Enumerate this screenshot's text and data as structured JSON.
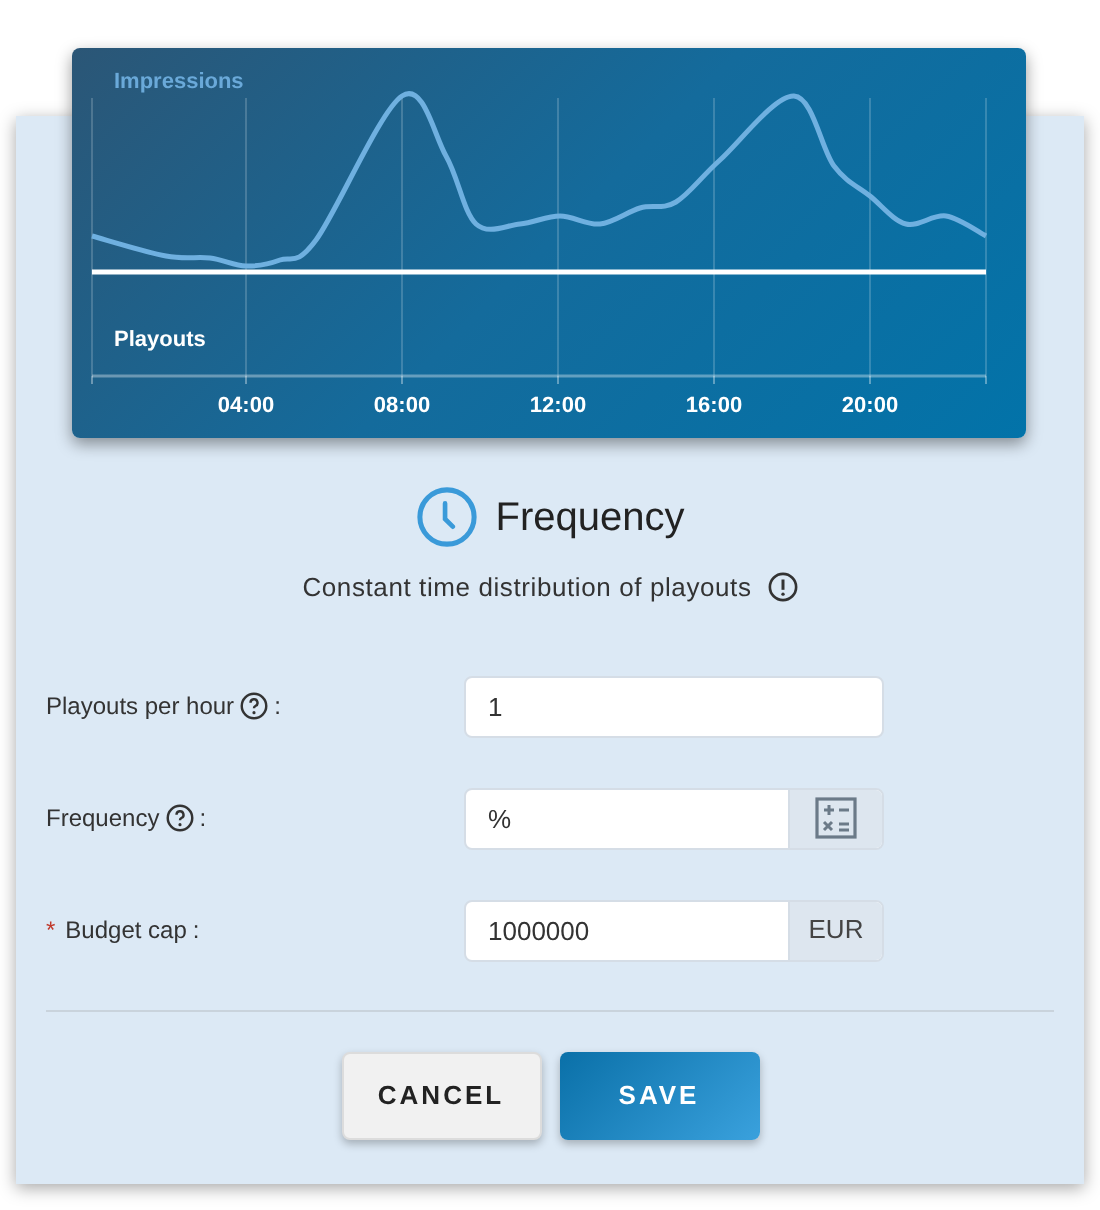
{
  "chart": {
    "impressions_label": "Impressions",
    "playouts_label": "Playouts",
    "x_ticks": [
      "04:00",
      "08:00",
      "12:00",
      "16:00",
      "20:00"
    ]
  },
  "header": {
    "title": "Frequency",
    "subtitle": "Constant time distribution of playouts"
  },
  "fields": [
    {
      "kind": "plain",
      "label": "Playouts per hour",
      "help": true,
      "required": false,
      "value": "1"
    },
    {
      "kind": "calculator",
      "label": "Frequency",
      "help": true,
      "required": false,
      "value": "%"
    },
    {
      "kind": "unit",
      "label": "Budget cap",
      "help": false,
      "required": true,
      "value": "1000000",
      "addon": "EUR"
    }
  ],
  "required_mark": "*",
  "label_suffix": ":",
  "buttons": [
    {
      "label": "CANCEL",
      "kind": "secondary"
    },
    {
      "label": "SAVE",
      "kind": "primary"
    }
  ]
}
